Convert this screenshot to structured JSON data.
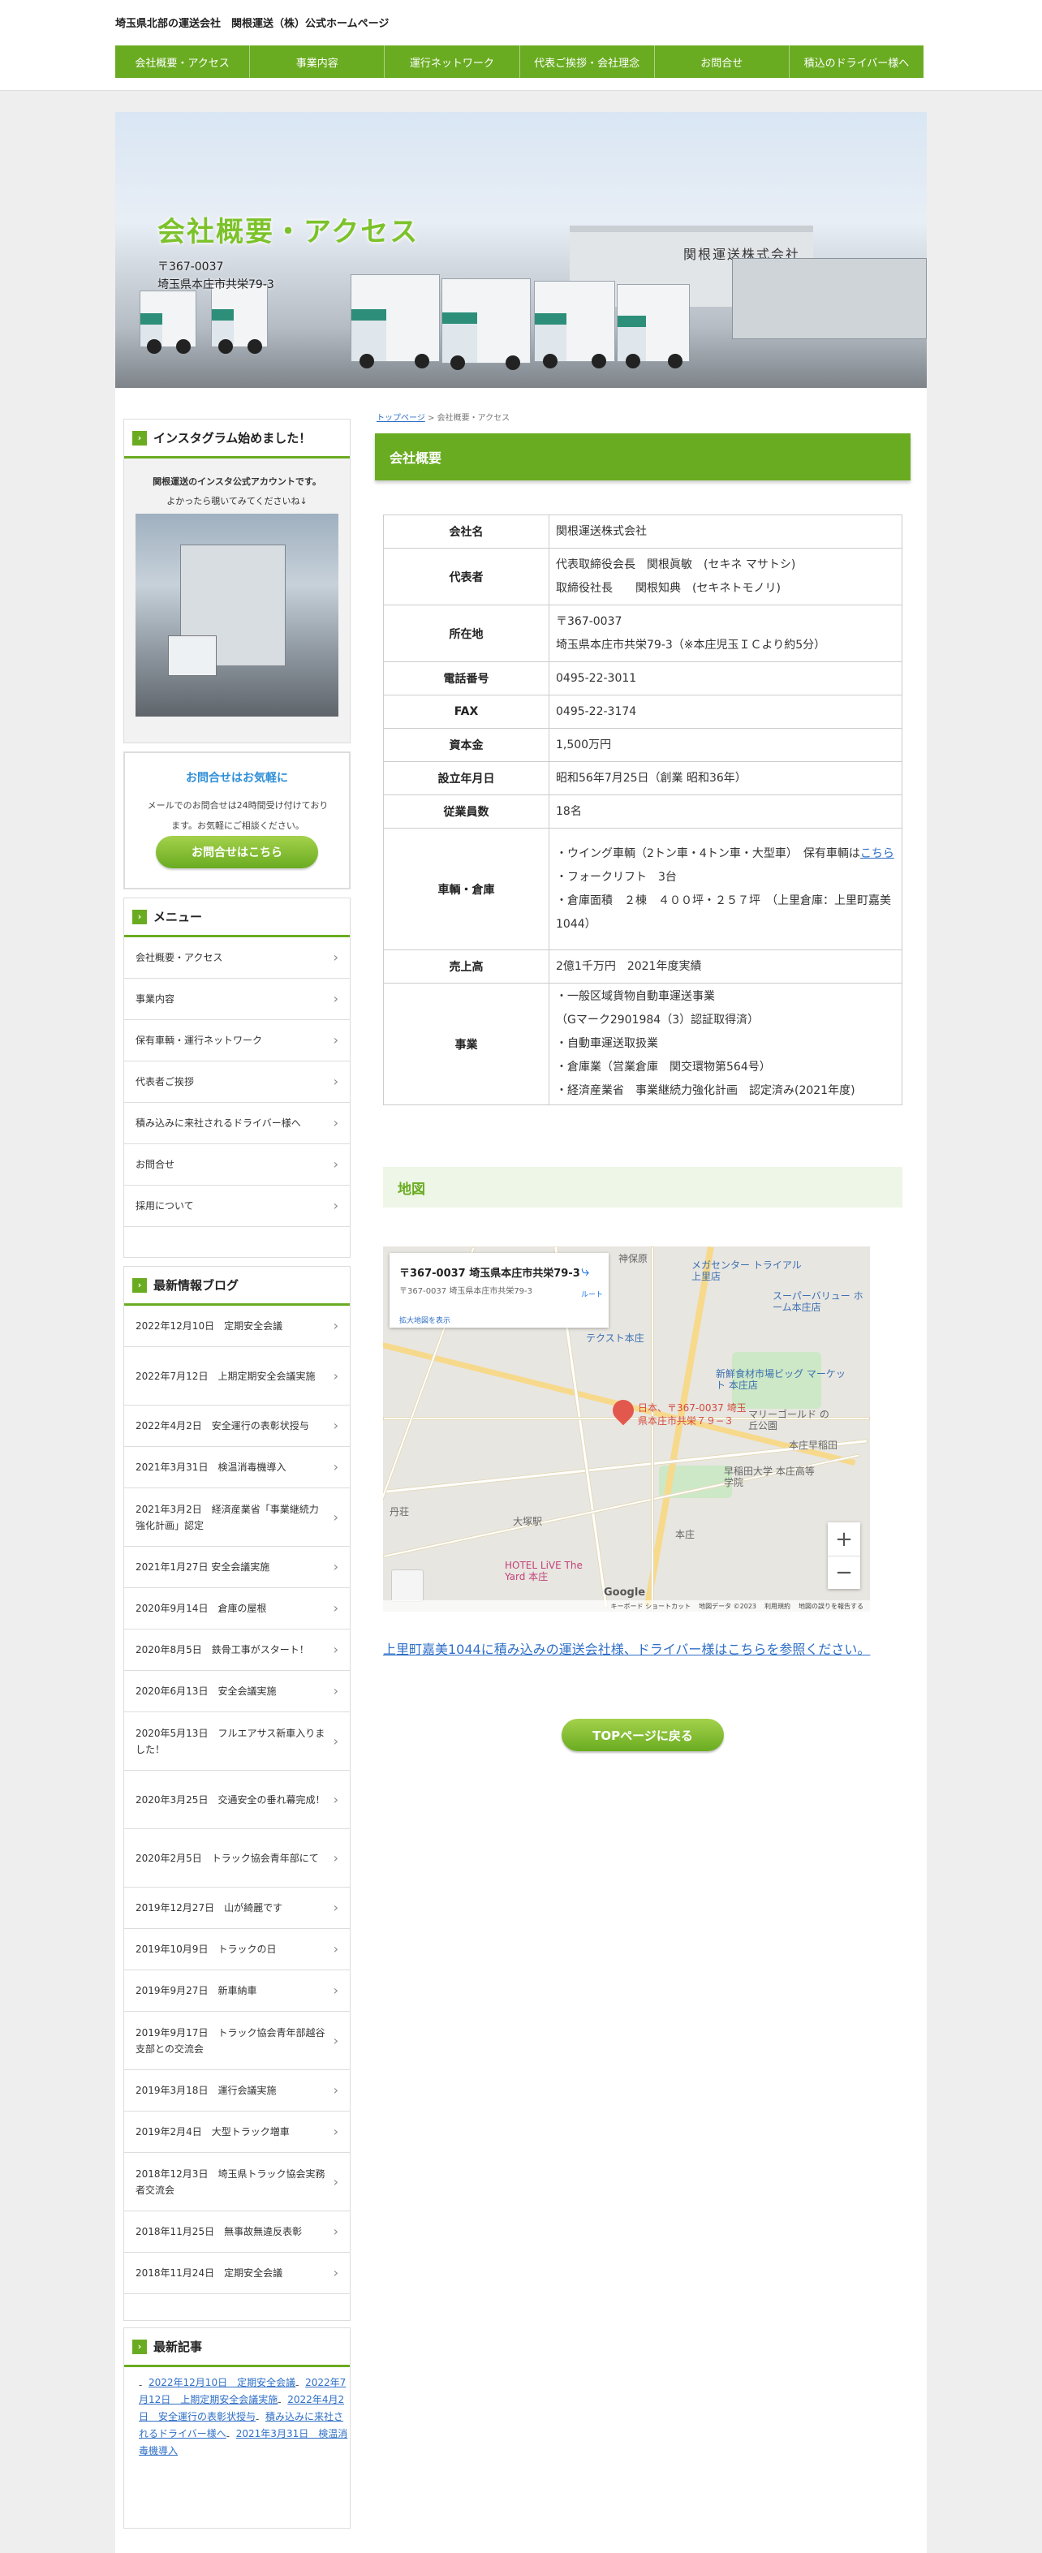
{
  "site": {
    "title": "埼玉県北部の運送会社　関根運送（株）公式ホームページ"
  },
  "nav": [
    "会社概要・アクセス",
    "事業内容",
    "運行ネットワーク",
    "代表ご挨拶・会社理念",
    "お問合せ",
    "積込のドライバー様へ"
  ],
  "hero": {
    "title": "会社概要・アクセス",
    "zip": "〒367-0037",
    "address": "埼玉県本庄市共栄79-3",
    "sign": "関根運送株式会社"
  },
  "breadcrumb": {
    "home": "トップページ",
    "sep": ">",
    "current": "会社概要・アクセス"
  },
  "section": {
    "heading": "会社概要"
  },
  "company_table": [
    {
      "label": "会社名",
      "lines": [
        "関根運送株式会社"
      ]
    },
    {
      "label": "代表者",
      "lines": [
        "代表取締役会長　関根眞敏　(セキネ マサトシ)",
        "取締役社長　　関根知典　(セキネトモノリ)"
      ]
    },
    {
      "label": "所在地",
      "lines": [
        "〒367-0037",
        "埼玉県本庄市共栄79-3（※本庄児玉ＩＣより約5分）"
      ]
    },
    {
      "label": "電話番号",
      "lines": [
        "0495-22-3011"
      ]
    },
    {
      "label": "FAX",
      "lines": [
        "0495-22-3174"
      ]
    },
    {
      "label": "資本金",
      "lines": [
        "1,500万円"
      ]
    },
    {
      "label": "設立年月日",
      "lines": [
        "昭和56年7月25日（創業 昭和36年）"
      ]
    },
    {
      "label": "従業員数",
      "lines": [
        "18名"
      ]
    },
    {
      "label": "車輌・倉庫",
      "lines": [
        "・ウイング車輌（2トン車・4トン車・大型車）　保有車輌は",
        "・フォークリフト　3台",
        "・倉庫面積　２棟　４００坪・２５７坪　（上里倉庫：上里町嘉美1044）"
      ],
      "link_text": "こちら"
    },
    {
      "label": "売上高",
      "lines": [
        "2億1千万円　2021年度実績"
      ]
    },
    {
      "label": "事業",
      "lines": [
        "・一般区域貨物自動車運送事業",
        "（Gマーク2901984（3）認証取得済）",
        "・自動車運送取扱業",
        "・倉庫業（営業倉庫　関交環物第564号）",
        "・経済産業省　事業継続力強化計画　認定済み(2021年度)"
      ]
    }
  ],
  "map": {
    "heading": "地図",
    "card_title": "〒367-0037 埼玉県本庄市共栄79-3",
    "card_sub": "〒367-0037 埼玉県本庄市共栄79-3",
    "card_link": "拡大地図を表示",
    "directions": "ルート",
    "pin_label_1": "日本、〒367-0037 埼玉",
    "pin_label_2": "県本庄市共栄７９−３",
    "places": [
      "神保原",
      "メガセンター トライアル上里店",
      "スーパーバリュー ホーム本庄店",
      "テクスト本庄",
      "新鮮食材市場ビッグ マーケット 本庄店",
      "マリーゴールド の丘公園",
      "本庄早稲田",
      "早稲田大学 本庄高等学院",
      "本庄",
      "丹荘",
      "HOTEL LiVE The Yard 本庄",
      "大塚駅"
    ],
    "zoom_in": "+",
    "zoom_out": "−",
    "google": "Google",
    "footer": [
      "キーボード ショートカット",
      "地図データ ©2023",
      "利用規約",
      "地図の誤りを報告する"
    ]
  },
  "map_link": "上里町嘉美1044に積み込みの運送会社様、ドライバー様はこちらを参照ください。",
  "top_button": "TOPページに戻る",
  "sidebar": {
    "insta": {
      "heading": "インスタグラム始めました！",
      "line1": "関根運送のインスタ公式アカウントです。",
      "line2": "よかったら覗いてみてくださいね↓"
    },
    "inquiry": {
      "heading": "お問合せはお気軽に",
      "line1": "メールでのお問合せは24時間受け付けており",
      "line2": "ます。お気軽にご相談ください。",
      "button": "お問合せはこちら"
    },
    "menu": {
      "heading": "メニュー",
      "items": [
        "会社概要・アクセス",
        "事業内容",
        "保有車輌・運行ネットワーク",
        "代表者ご挨拶",
        "積み込みに来社されるドライバー様へ",
        "お問合せ",
        "採用について"
      ]
    },
    "blog": {
      "heading": "最新情報ブログ",
      "items": [
        "2022年12月10日　定期安全会議",
        "2022年7月12日　上期定期安全会議実施",
        "2022年4月2日　安全運行の表彰状授与",
        "2021年3月31日　検温消毒機導入",
        "2021年3月2日　経済産業省「事業継続力強化計画」認定",
        "2021年1月27日 安全会議実施",
        "2020年9月14日　倉庫の屋根",
        "2020年8月5日　鉄骨工事がスタート！",
        "2020年6月13日　安全会議実施",
        "2020年5月13日　フルエアサス新車入りました！",
        "2020年3月25日　交通安全の垂れ幕完成！",
        "2020年2月5日　トラック協会青年部にて",
        "2019年12月27日　山が綺麗です",
        "2019年10月9日　トラックの日",
        "2019年9月27日　新車納車",
        "2019年9月17日　トラック協会青年部越谷支部との交流会",
        "2019年3月18日　運行会議実施",
        "2019年2月4日　大型トラック増車",
        "2018年12月3日　埼玉県トラック協会実務者交流会",
        "2018年11月25日　無事故無違反表彰",
        "2018年11月24日　定期安全会議"
      ]
    },
    "recent": {
      "heading": "最新記事",
      "items": [
        "2022年12月10日　定期安全会議",
        "2022年7月12日　上期定期安全会議実施",
        "2022年4月2日　安全運行の表彰状授与",
        "積み込みに来社されるドライバー様へ",
        "2021年3月31日　検温消毒機導入"
      ]
    }
  },
  "colors": {
    "accent": "#6aac21",
    "link": "#2f6fc6",
    "inquiry_heading": "#2f8fd8"
  },
  "icons": {
    "heading_marker": "chevron-right-icon",
    "list_arrow": "chevron-right-icon",
    "map_pin": "map-pin-icon",
    "directions": "directions-icon"
  }
}
